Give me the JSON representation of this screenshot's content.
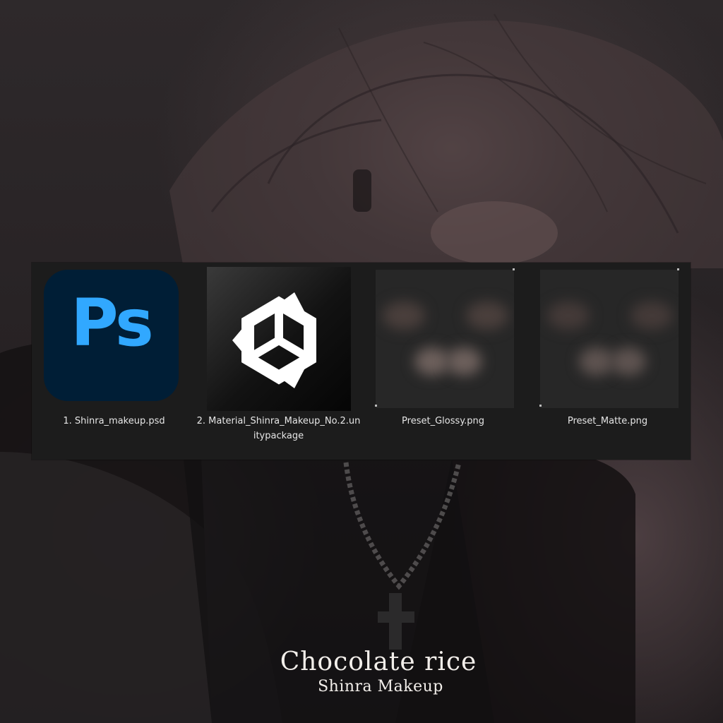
{
  "files": [
    {
      "name": "1. Shinra_makeup.psd",
      "icon": "photoshop-icon",
      "icon_text": "Ps"
    },
    {
      "name": "2. Material_Shinra_Makeup_No.2.unitypackage",
      "icon": "unity-icon"
    },
    {
      "name": "Preset_Glossy.png",
      "icon": "image-thumbnail"
    },
    {
      "name": "Preset_Matte.png",
      "icon": "image-thumbnail"
    }
  ],
  "brand": {
    "title": "Chocolate rice",
    "subtitle": "Shinra Makeup"
  },
  "colors": {
    "panel_bg": "#1c1c1c",
    "ps_bg": "#001e36",
    "ps_fg": "#31a8ff",
    "caption_text": "#e6e6e6"
  }
}
